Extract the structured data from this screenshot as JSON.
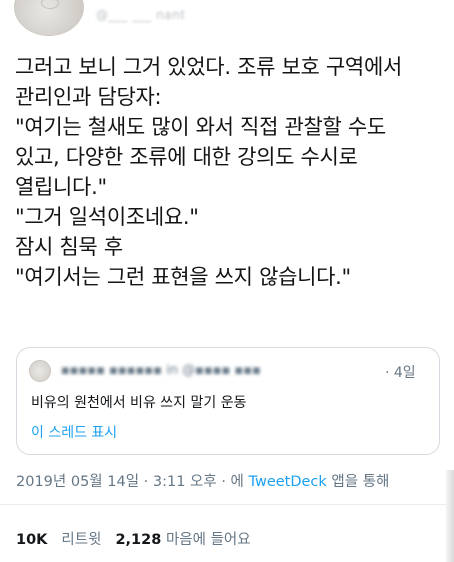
{
  "header": {
    "handle": "@___ ___ nant"
  },
  "tweet": {
    "lines": [
      "그러고 보니 그거 있었다. 조류 보호 구역에서",
      "관리인과 담당자:",
      "\"여기는 철새도 많이 와서 직접 관찰할 수도",
      "있고, 다양한 조류에 대한 강의도 수시로",
      "열립니다.\"",
      "\"그거 일석이조네요.\"",
      "잠시 침묵 후",
      "\"여기서는 그런 표현을 쓰지 않습니다.\""
    ]
  },
  "quote": {
    "name": "▪▪▪▪▪ ▪▪▪▪▪▪ in @▪▪▪▪ ▪▪▪▪ ▪c",
    "time": "· 4일",
    "text": "비유의 원천에서 비유 쓰지 말기 운동",
    "thread_link": "이 스레드 표시"
  },
  "meta": {
    "timestamp": "2019년 05월 14일 · 3:11 오후 · 에 ",
    "client": "TweetDeck",
    "suffix": " 앱을 통해"
  },
  "stats": {
    "retweets_count": "10K",
    "retweets_label": "리트윗",
    "likes_count": "2,128",
    "likes_label": "마음에 들어요"
  },
  "colors": {
    "link": "#1da1f2",
    "muted": "#657786",
    "text": "#14171a",
    "border": "#d4dadf"
  }
}
